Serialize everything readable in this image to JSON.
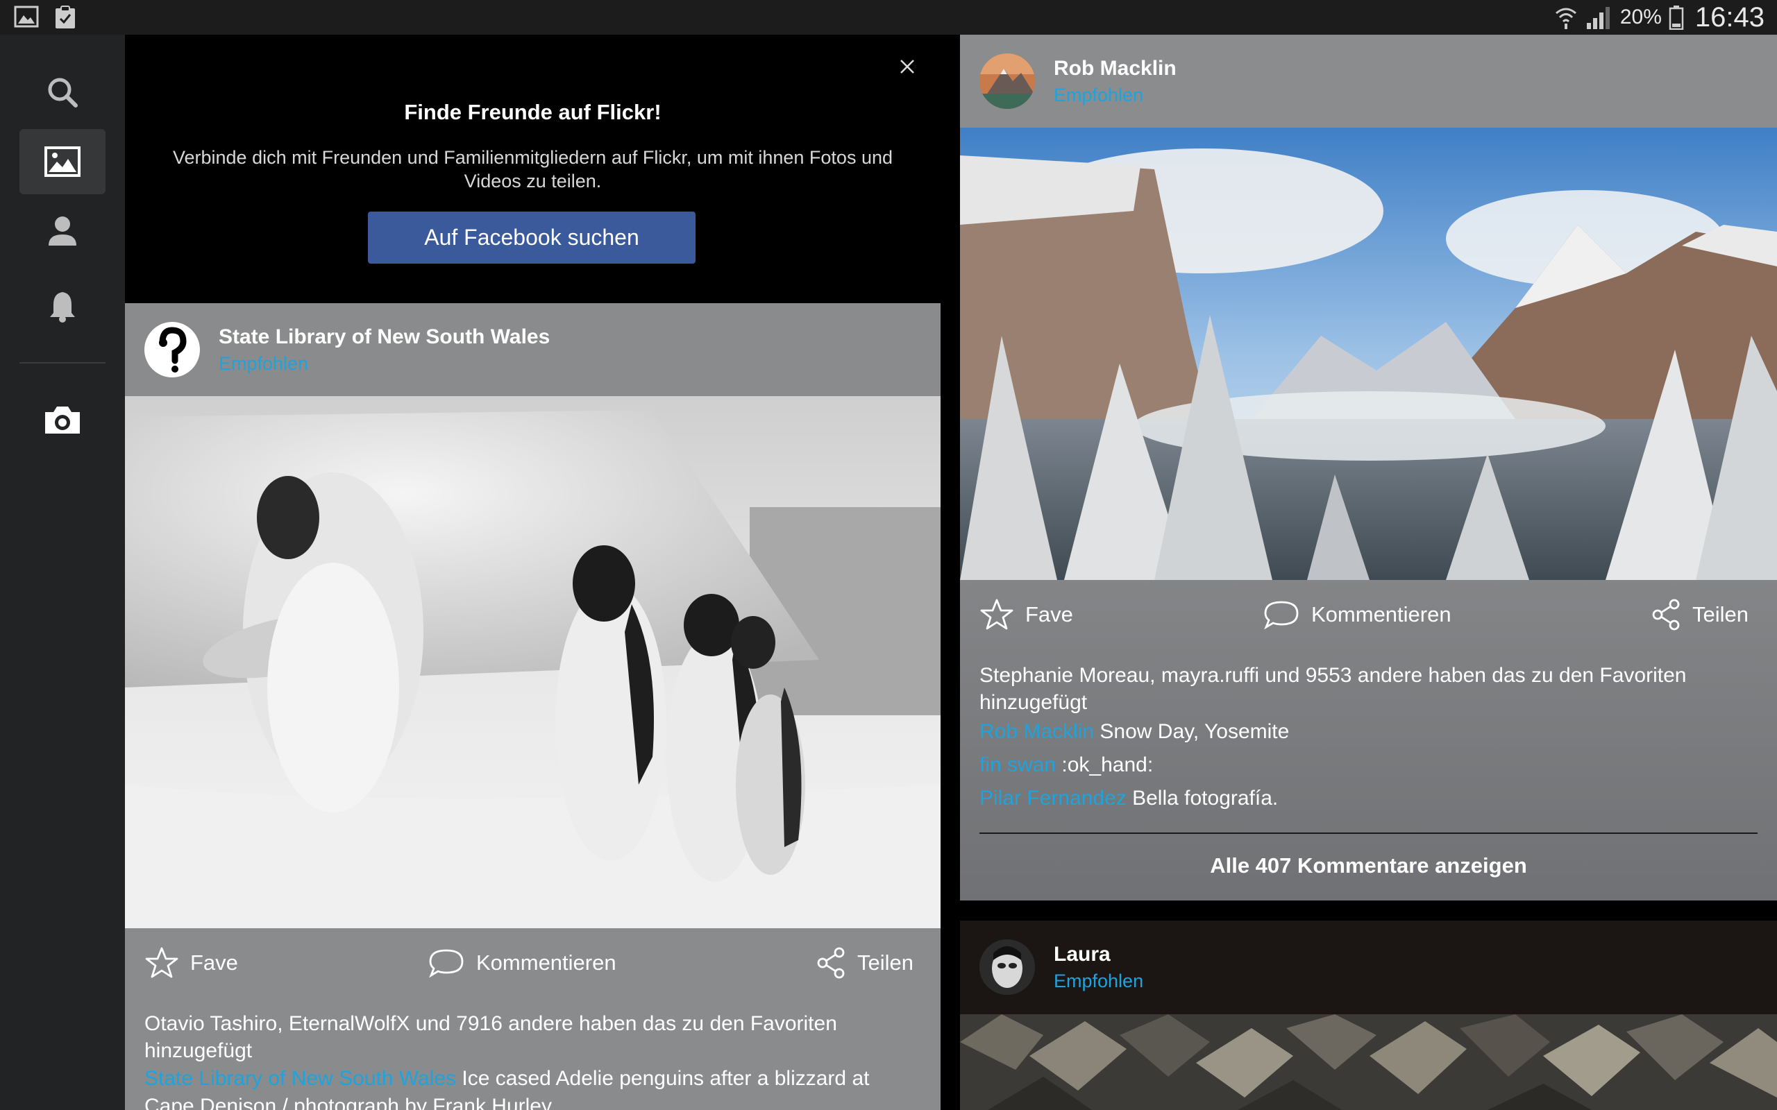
{
  "status_bar": {
    "battery_percent": "20%",
    "time": "16:43",
    "icons": [
      "gallery-icon",
      "clipboard-check-icon",
      "wifi-icon",
      "signal-icon",
      "battery-icon"
    ]
  },
  "sidebar": {
    "items": [
      {
        "name": "search",
        "icon": "search-icon"
      },
      {
        "name": "feed",
        "icon": "image-icon",
        "active": true
      },
      {
        "name": "profile",
        "icon": "person-icon"
      },
      {
        "name": "notifications",
        "icon": "bell-icon"
      },
      {
        "name": "camera",
        "icon": "camera-icon"
      }
    ]
  },
  "banner": {
    "title": "Finde Freunde auf Flickr!",
    "text": "Verbinde dich mit Freunden und Familienmitgliedern auf Flickr, um mit ihnen Fotos und Videos zu teilen.",
    "button_label": "Auf Facebook suchen"
  },
  "posts": [
    {
      "owner": "State Library of New South Wales",
      "subtitle": "Empfohlen",
      "actions": {
        "fave": "Fave",
        "comment": "Kommentieren",
        "share": "Teilen"
      },
      "faves": {
        "names": [
          "Otavio Tashiro",
          "EternalWolfX"
        ],
        "sep": ", ",
        "rest": " und 7916 andere haben das zu den Favoriten hinzugefügt"
      },
      "comments": [
        {
          "author": "State Library of New South Wales",
          "text": " Ice cased Adelie penguins after a blizzard at Cape Denison / photograph by Frank Hurley"
        }
      ]
    },
    {
      "owner": "Rob Macklin",
      "subtitle": "Empfohlen",
      "actions": {
        "fave": "Fave",
        "comment": "Kommentieren",
        "share": "Teilen"
      },
      "faves": {
        "names": [
          "Stephanie Moreau",
          "mayra.ruffi"
        ],
        "sep": ", ",
        "rest": " und 9553 andere haben das zu den Favoriten hinzugefügt"
      },
      "comments": [
        {
          "author": "Rob Macklin",
          "text": " Snow Day, Yosemite"
        },
        {
          "author": "fin swan",
          "text": " :ok_hand:"
        },
        {
          "author": "Pilar Fernandez",
          "text": " Bella fotografía."
        }
      ],
      "view_all": "Alle 407 Kommentare anzeigen"
    },
    {
      "owner": "Laura",
      "subtitle": "Empfohlen"
    }
  ],
  "colors": {
    "accent": "#1fa3dc",
    "facebook": "#3a5a9b",
    "card": "#8a8b8c",
    "sidebar": "#222324"
  }
}
